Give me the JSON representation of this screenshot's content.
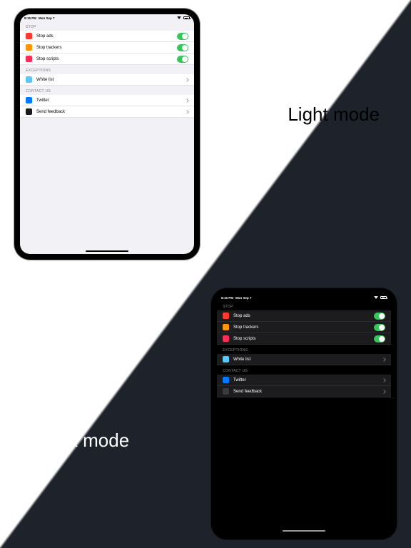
{
  "labels": {
    "light": "Light mode",
    "dark": "Dark mode"
  },
  "status": {
    "time": "8:15 PM",
    "date": "Mon Sep 7"
  },
  "sections": {
    "stop": "STOP",
    "exceptions": "EXCEPTIONS",
    "contact": "CONTACT US"
  },
  "rows": {
    "stop_ads": "Stop ads",
    "stop_trackers": "Stop trackers",
    "stop_scripts": "Stop scripts",
    "white_list": "White list",
    "twitter": "Twitter",
    "send_feedback": "Send feedback"
  }
}
